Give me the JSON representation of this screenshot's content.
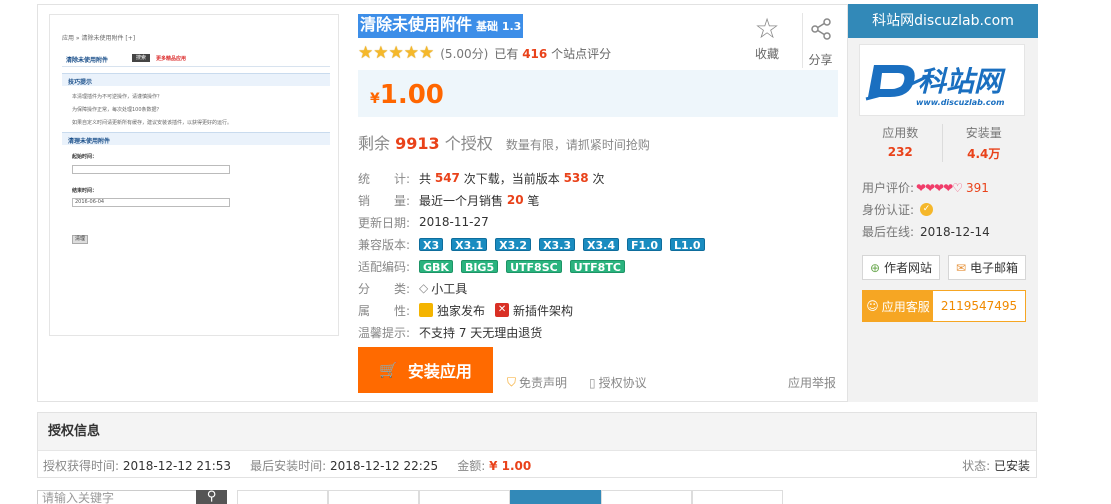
{
  "preview": {
    "breadcrumb": "应用 » 清除未使用附件 [+]",
    "title": "清除未使用附件",
    "btn": "搜索",
    "more": "更多精品应用",
    "section1": "技巧提示",
    "tips": [
      "本清理插件为不可逆操作，请谨慎操作？",
      "为保障操作正常，每次处理100条数据？",
      "如果自定义时间请更新所有缓存，建议安装该插件，以获得更好的运行。"
    ],
    "section2": "清理未使用附件",
    "start_label": "起始时间：",
    "end_label": "结束时间：",
    "end_value": "2016-06-04",
    "submit": "清理"
  },
  "app": {
    "title": "清除未使用附件",
    "badge": "基础 1.3",
    "score": "(5.00分)",
    "rating_prefix": "已有",
    "rating_count": "416",
    "rating_suffix": "个站点评分",
    "fav": "收藏",
    "share": "分享",
    "price_symbol": "¥",
    "price": "1.00",
    "remaining_prefix": "剩余",
    "remaining_num": "9913",
    "remaining_suffix": "个授权",
    "remaining_note": "数量有限，请抓紧时间抢购",
    "stats_label": "统　　计:",
    "stats_a": "共",
    "stats_downloads": "547",
    "stats_b": "次下载，当前版本",
    "stats_current": "538",
    "stats_c": "次",
    "sales_label": "销　　量:",
    "sales_a": "最近一个月销售",
    "sales_num": "20",
    "sales_b": "笔",
    "updated_label": "更新日期:",
    "updated": "2018-11-27",
    "compat_label": "兼容版本:",
    "compat": [
      "X3",
      "X3.1",
      "X3.2",
      "X3.3",
      "X3.4",
      "F1.0",
      "L1.0"
    ],
    "encoding_label": "适配编码:",
    "encoding": [
      "GBK",
      "BIG5",
      "UTF8SC",
      "UTF8TC"
    ],
    "category_label": "分　　类:",
    "category": "小工具",
    "attr_label": "属　　性:",
    "attr_exclusive": "独家发布",
    "attr_newarch": "新插件架构",
    "notice_label": "温馨提示:",
    "notice": "不支持 7 天无理由退货",
    "install": "安装应用",
    "disclaimer": "免责声明",
    "license_agreement": "授权协议",
    "report": "应用举报"
  },
  "author": {
    "header": "科站网discuzlab.com",
    "logo_text": "科站网",
    "logo_url": "www.discuzlab.com",
    "apps_label": "应用数",
    "apps": "232",
    "installs_label": "安装量",
    "installs": "4.4万",
    "rating_label": "用户评价:",
    "hearts": "❤❤❤❤♡",
    "rating_count": "391",
    "identity_label": "身份认证:",
    "last_online_label": "最后在线:",
    "last_online": "2018-12-14",
    "website": "作者网站",
    "email": "电子邮箱",
    "support_label": "应用客服",
    "support_qq": "2119547495"
  },
  "license": {
    "title": "授权信息",
    "acquired_label": "授权获得时间:",
    "acquired": "2018-12-12 21:53",
    "last_install_label": "最后安装时间:",
    "last_install": "2018-12-12 22:25",
    "amount_label": "金额:",
    "amount": "¥ 1.00",
    "status_label": "状态:",
    "status": "已安装"
  },
  "search": {
    "placeholder": "请输入关键字"
  },
  "colors": {
    "accent": "#3289b8",
    "price": "#ff6600",
    "install": "#ff6a00",
    "support": "#f6a623"
  }
}
